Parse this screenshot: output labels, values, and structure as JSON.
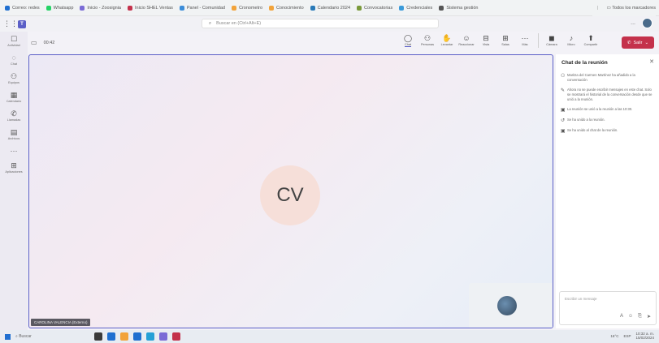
{
  "browser": {
    "bookmarks": [
      {
        "label": "Correo: redes",
        "color": "#1f6fd0"
      },
      {
        "label": "Whatsapp",
        "color": "#25d366"
      },
      {
        "label": "Inicio - Zoosignia",
        "color": "#7a6bd6"
      },
      {
        "label": "Inicio SHEL Ventas",
        "color": "#c4314b"
      },
      {
        "label": "Panel - Comunidad",
        "color": "#3c8dd9"
      },
      {
        "label": "Cronometro",
        "color": "#f2a33a"
      },
      {
        "label": "Conocimiento",
        "color": "#f2a33a"
      },
      {
        "label": "Calendario 2024",
        "color": "#2a7ab8"
      },
      {
        "label": "Convocatorias",
        "color": "#7a9a3a"
      },
      {
        "label": "Credenciales",
        "color": "#3a9ad9"
      },
      {
        "label": "Sistema gestión",
        "color": "#555555"
      }
    ],
    "bookmarks_right": "Todos los marcadores"
  },
  "teams": {
    "search_placeholder": "Buscar en (Ctrl+Alt+E)",
    "more_label": "...",
    "rail": [
      {
        "icon": "activity-icon",
        "glyph": "☐",
        "label": "Actividad"
      },
      {
        "icon": "chat-icon",
        "glyph": "◌",
        "label": "Chat"
      },
      {
        "icon": "teams-icon",
        "glyph": "⚇",
        "label": "Equipos"
      },
      {
        "icon": "calendar-icon",
        "glyph": "▦",
        "label": "Calendario"
      },
      {
        "icon": "calls-icon",
        "glyph": "✆",
        "label": "Llamadas"
      },
      {
        "icon": "files-icon",
        "glyph": "▤",
        "label": "Archivos"
      },
      {
        "icon": "more-apps-icon",
        "glyph": "···",
        "label": ""
      },
      {
        "icon": "apps-icon",
        "glyph": "⊞",
        "label": "Aplicaciones"
      }
    ]
  },
  "meeting": {
    "timer": "00:42",
    "tools": [
      {
        "name": "chat",
        "glyph": "◯",
        "label": "Chat",
        "active": true
      },
      {
        "name": "people",
        "glyph": "⚇",
        "label": "Personas",
        "active": false
      },
      {
        "name": "raise",
        "glyph": "✋",
        "label": "Levantar",
        "active": false
      },
      {
        "name": "react",
        "glyph": "☺",
        "label": "Reaccionar",
        "active": false
      },
      {
        "name": "view",
        "glyph": "⊟",
        "label": "Vista",
        "active": false
      },
      {
        "name": "rooms",
        "glyph": "⊞",
        "label": "Salas",
        "active": false
      },
      {
        "name": "more",
        "glyph": "···",
        "label": "Más",
        "active": false
      }
    ],
    "camera_label": "Cámara",
    "mic_label": "Micro",
    "share_label": "Compartir",
    "leave_label": "Salir",
    "participant_initials": "CV",
    "name_tag": "CAROLINA VALENCIA (Externo)"
  },
  "chat_panel": {
    "title": "Chat de la reunión",
    "messages": [
      {
        "icon": "person-add-icon",
        "glyph": "⚇",
        "text": "Maritza del Carmen Martínez ha añadido a la conversación"
      },
      {
        "icon": "edit-icon",
        "glyph": "✎",
        "text": "Ahora no se puede escribir mensajes en este chat. Solo se mostrará el historial de la conversación desde que se unió a la reunión."
      },
      {
        "icon": "meeting-icon",
        "glyph": "▣",
        "text": "La reunión se unió a la reunión a las 10:30."
      },
      {
        "icon": "join-icon",
        "glyph": "↺",
        "text": "Se ha unido a la reunión."
      },
      {
        "icon": "meeting-icon",
        "glyph": "▣",
        "text": "Se ha unido al chat de la reunión."
      }
    ],
    "composer_placeholder": "Escribir un mensaje"
  },
  "taskbar": {
    "search_label": "Buscar",
    "apps": [
      "#3a3a3a",
      "#1f6fd0",
      "#f2a33a",
      "#1f6fd0",
      "#25a0d6",
      "#7a6bd6",
      "#c4314b"
    ],
    "weather": "16°C",
    "lang": "ESP",
    "time": "10:32 a. m.",
    "date": "15/02/2024"
  }
}
